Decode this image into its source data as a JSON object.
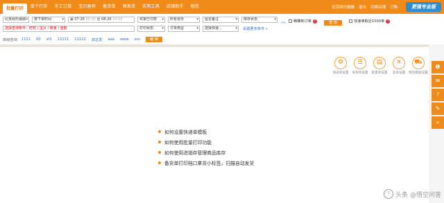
{
  "nav": {
    "items": [
      "批量打印",
      "单个打印",
      "手工订单",
      "宝贝备称",
      "备货单",
      "预发货",
      "实用工具",
      "店铺助手",
      "短信"
    ],
    "active_index": 0
  },
  "topright": {
    "shop": "北京网乐融融",
    "exit": "退出",
    "mobile": "切换店铺",
    "order": "订购",
    "promo": "更强专业版"
  },
  "filters": {
    "shop_select": "北京网乐融融",
    "order_time": "按下单时间",
    "date_from": "07-26",
    "time_from": "00:00",
    "date_to_label": "至",
    "date_to": "08-26",
    "time_to": "23:59",
    "pay_status": "买家已付款",
    "province": "所有省份",
    "remark": "留言备注",
    "stock": "库存状态",
    "query_cond": "选择查询条件：旺旺 / 宝贝 / 数量 / 金额",
    "print_status": "打印状态",
    "order_type": "订单类型",
    "express": "选择快递...",
    "more": "设置更多条件 »",
    "exact_label": "精确到订单",
    "query_btn": "查 询",
    "limit_label": "快速读取近1000单"
  },
  "advanced": {
    "label": "高级查询",
    "tags": [
      "1111",
      "00",
      "xf1",
      "11111",
      "11112",
      "双达发",
      "aaa",
      "www",
      "sss"
    ],
    "edit": "编 辑"
  },
  "tools": [
    {
      "label": "快递单设置",
      "icon": "gear-doc-icon",
      "glyph": "⚙"
    },
    {
      "label": "发货单设置",
      "icon": "list-icon",
      "glyph": "☰"
    },
    {
      "label": "批量单设置",
      "icon": "stack-icon",
      "glyph": "▤"
    },
    {
      "label": "高单设置",
      "icon": "tools-icon",
      "glyph": "✕"
    },
    {
      "label": "物流模板设置",
      "icon": "truck-icon",
      "glyph": "⛟"
    }
  ],
  "tips": [
    "如何设置快递单模板",
    "如何使用批量打印功能",
    "如何使用进销存管理商品库存",
    "备货单打印档口拿货小标签，扫描自动发货"
  ],
  "side_icons": [
    "❶",
    "✉",
    "?",
    "✎",
    "»"
  ],
  "watermark": "头条 @悟空问答",
  "colors": {
    "accent": "#f08a18",
    "link": "#2a6fc9",
    "danger": "#dd0000"
  }
}
